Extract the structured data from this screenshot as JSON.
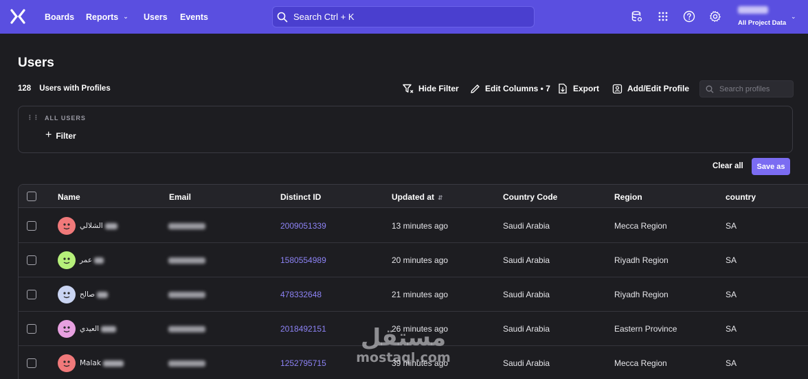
{
  "nav": {
    "items": [
      {
        "label": "Boards"
      },
      {
        "label": "Reports"
      },
      {
        "label": "Users"
      },
      {
        "label": "Events"
      }
    ],
    "search_label": "Search  Ctrl + K",
    "project_label": "All Project Data",
    "brand_color": "#5a4fe0"
  },
  "page": {
    "title": "Users",
    "count": "128",
    "count_label": "Users with Profiles",
    "toolbar": {
      "hide_filter": "Hide Filter",
      "edit_columns": "Edit Columns • 7",
      "export": "Export",
      "add_edit_profile": "Add/Edit Profile"
    },
    "search_placeholder": "Search profiles"
  },
  "filter": {
    "segment_label": "ALL USERS",
    "add_filter": "Filter",
    "clear_all": "Clear all",
    "save_as": "Save as"
  },
  "table": {
    "columns": [
      "Name",
      "Email",
      "Distinct ID",
      "Updated at",
      "Country Code",
      "Region",
      "country"
    ],
    "rows": [
      {
        "name": "الشلالي",
        "distinct_id": "2009051339",
        "updated": "13 minutes ago",
        "country_code": "Saudi Arabia",
        "region": "Mecca Region",
        "country": "SA",
        "avatar_color": "#f0797a"
      },
      {
        "name": "عمر",
        "distinct_id": "1580554989",
        "updated": "20 minutes ago",
        "country_code": "Saudi Arabia",
        "region": "Riyadh Region",
        "country": "SA",
        "avatar_color": "#b6f07a"
      },
      {
        "name": "صالح",
        "distinct_id": "478332648",
        "updated": "21 minutes ago",
        "country_code": "Saudi Arabia",
        "region": "Riyadh Region",
        "country": "SA",
        "avatar_color": "#c9d4f2"
      },
      {
        "name": "العيدي",
        "distinct_id": "2018492151",
        "updated": "26 minutes ago",
        "country_code": "Saudi Arabia",
        "region": "Eastern Province",
        "country": "SA",
        "avatar_color": "#e7a0e0"
      },
      {
        "name": "Malak",
        "distinct_id": "1252795715",
        "updated": "39 minutes ago",
        "country_code": "Saudi Arabia",
        "region": "Mecca Region",
        "country": "SA",
        "avatar_color": "#f0797a"
      }
    ]
  },
  "watermark": {
    "arabic": "مستقل",
    "latin": "mostaql.com"
  }
}
